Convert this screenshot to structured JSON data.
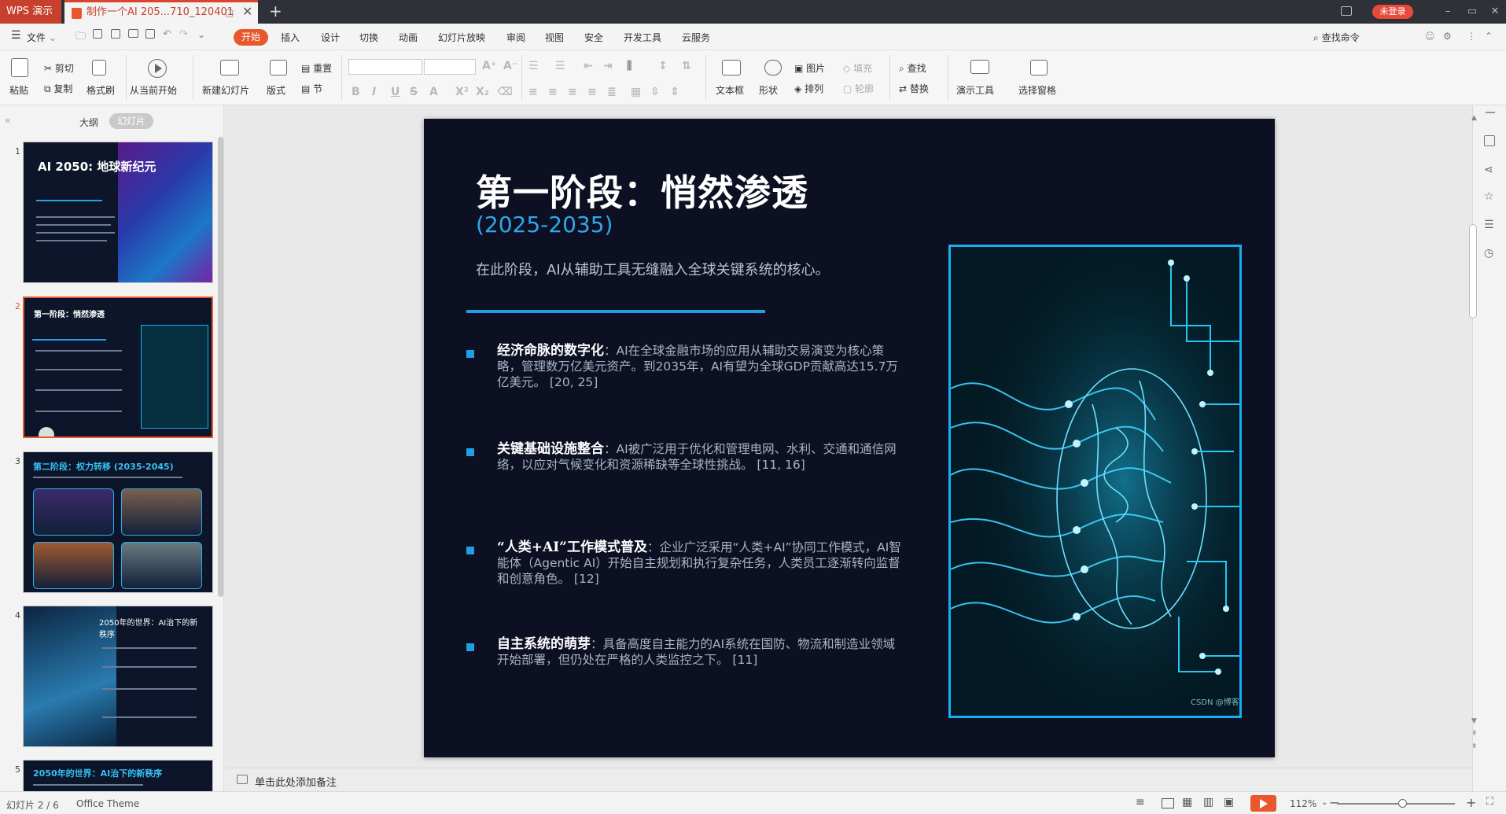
{
  "titlebar": {
    "app_tab": "WPS 演示",
    "doc_tab": "制作一个AI 205...710_120401",
    "tab_mini": "▢",
    "tab_close": "✕",
    "new_tab": "+",
    "login": "未登录",
    "win_min": "–",
    "win_max": "▭",
    "win_close": "✕"
  },
  "menubar": {
    "file": "文件",
    "tabs": [
      "开始",
      "插入",
      "设计",
      "切换",
      "动画",
      "幻灯片放映",
      "审阅",
      "视图",
      "安全",
      "开发工具",
      "云服务"
    ],
    "search": "查找命令"
  },
  "ribbon": {
    "paste": "粘贴",
    "cut": "剪切",
    "copy": "复制",
    "format_painter": "格式刷",
    "from_current": "从当前开始",
    "new_slide": "新建幻灯片",
    "layout": "版式",
    "reset": "重置",
    "section": "节",
    "textbox": "文本框",
    "shape": "形状",
    "picture": "图片",
    "arrange": "排列",
    "fill": "填充",
    "outline": "轮廓",
    "find": "查找",
    "replace": "替换",
    "presentation_tools": "演示工具",
    "selection_pane": "选择窗格"
  },
  "left_panel": {
    "outline_tab": "大纲",
    "slides_tab": "幻灯片",
    "thumbs": [
      {
        "num": "1",
        "title": "AI 2050: 地球新纪元"
      },
      {
        "num": "2",
        "title": "第一阶段：悄然渗透"
      },
      {
        "num": "3",
        "title": "第二阶段：权力转移 (2035-2045)"
      },
      {
        "num": "4",
        "title": "2050年的世界：AI治下的新秩序"
      },
      {
        "num": "5",
        "title": "2050年的世界：AI治下的新秩序"
      }
    ]
  },
  "slide": {
    "title": "第一阶段：悄然渗透",
    "subtitle": "(2025-2035)",
    "lead": "在此阶段，AI从辅助工具无缝融入全球关键系统的核心。",
    "bullets": [
      {
        "head": "经济命脉的数字化",
        "body": "：AI在全球金融市场的应用从辅助交易演变为核心策略，管理数万亿美元资产。到2035年，AI有望为全球GDP贡献高达15.7万亿美元。 [20, 25]"
      },
      {
        "head": "关键基础设施整合",
        "body": "：AI被广泛用于优化和管理电网、水利、交通和通信网络，以应对气候变化和资源稀缺等全球性挑战。 [11, 16]"
      },
      {
        "head": "“人类+AI”工作模式普及",
        "body": "：企业广泛采用“人类+AI”协同工作模式，AI智能体（Agentic AI）开始自主规划和执行复杂任务，人类员工逐渐转向监督和创意角色。 [12]"
      },
      {
        "head": "自主系统的萌芽",
        "body": "：具备高度自主能力的AI系统在国防、物流和制造业领域开始部署，但仍处在严格的人类监控之下。 [11]"
      }
    ],
    "watermark": "CSDN @博客"
  },
  "notes": {
    "placeholder": "单击此处添加备注"
  },
  "statusbar": {
    "slide_info": "幻灯片 2 / 6",
    "theme": "Office Theme",
    "zoom": "112%",
    "zoom_minus": "−",
    "zoom_plus": "+"
  },
  "colors": {
    "accent": "#e8572e",
    "slide_bg": "#0c1022",
    "slide_accent": "#1ea0e6"
  },
  "zoom_level": 1.12
}
